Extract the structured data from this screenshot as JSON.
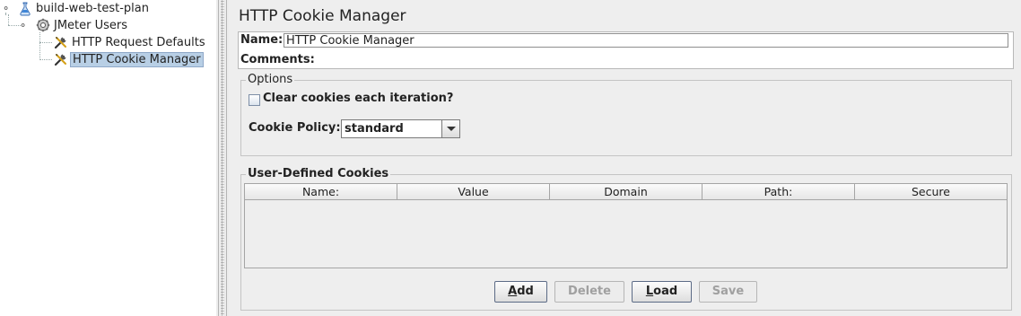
{
  "tree": {
    "items": [
      {
        "label": "build-web-test-plan",
        "icon": "flask-icon"
      },
      {
        "label": "JMeter Users",
        "icon": "gear-icon"
      },
      {
        "label": "HTTP Request Defaults",
        "icon": "wrench-icon"
      },
      {
        "label": "HTTP Cookie Manager",
        "icon": "wrench-icon",
        "selected": true
      }
    ]
  },
  "panel": {
    "title": "HTTP Cookie Manager",
    "name_label": "Name:",
    "name_value": "HTTP Cookie Manager",
    "comments_label": "Comments:",
    "options": {
      "title": "Options",
      "clear_cookies_label": "Clear cookies each iteration?",
      "clear_cookies_checked": false,
      "policy_label": "Cookie Policy:",
      "policy_value": "standard"
    },
    "cookies": {
      "title": "User-Defined Cookies",
      "columns": [
        "Name:",
        "Value",
        "Domain",
        "Path:",
        "Secure"
      ],
      "rows": []
    },
    "buttons": {
      "add": {
        "mnemonic": "A",
        "rest": "dd",
        "enabled": true
      },
      "delete": {
        "label": "Delete",
        "enabled": false
      },
      "load": {
        "mnemonic": "L",
        "rest": "oad",
        "enabled": true
      },
      "save": {
        "label": "Save",
        "enabled": false
      }
    }
  },
  "colors": {
    "selection": "#b8cfe5",
    "panel_bg": "#eeeeee",
    "tree_bg": "#ffffff"
  }
}
